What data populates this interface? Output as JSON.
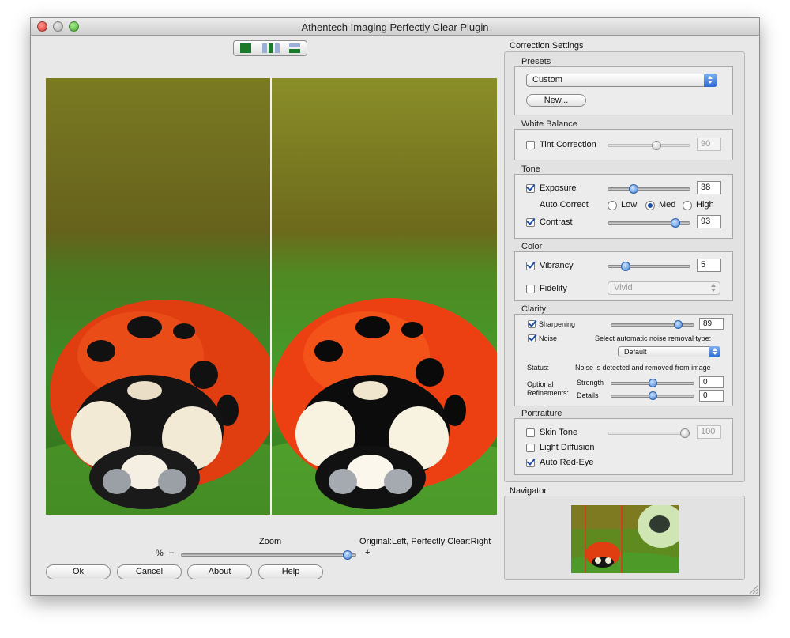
{
  "window": {
    "title": "Athentech Imaging Perfectly Clear Plugin"
  },
  "preview": {
    "zoom_label": "Zoom",
    "orientation_label": "Original:Left, Perfectly Clear:Right",
    "zoom_percent_label": "%",
    "zoom_minus": "–",
    "zoom_plus": "+",
    "zoom_level": 0.98
  },
  "buttons": {
    "ok": "Ok",
    "cancel": "Cancel",
    "about": "About",
    "help": "Help"
  },
  "settings": {
    "title": "Correction Settings",
    "presets": {
      "title": "Presets",
      "selected": "Custom",
      "new_label": "New..."
    },
    "white_balance": {
      "title": "White Balance",
      "tint": {
        "label": "Tint Correction",
        "checked": false,
        "value": "90",
        "level": 0.6
      }
    },
    "tone": {
      "title": "Tone",
      "exposure": {
        "label": "Exposure",
        "checked": true,
        "value": "38",
        "level": 0.29
      },
      "auto_correct": {
        "label": "Auto Correct",
        "options": [
          "Low",
          "Med",
          "High"
        ],
        "selected": "Med"
      },
      "contrast": {
        "label": "Contrast",
        "checked": true,
        "value": "93",
        "level": 0.87
      }
    },
    "color": {
      "title": "Color",
      "vibrancy": {
        "label": "Vibrancy",
        "checked": true,
        "value": "5",
        "level": 0.18
      },
      "fidelity": {
        "label": "Fidelity",
        "checked": false,
        "selected": "Vivid"
      }
    },
    "clarity": {
      "title": "Clarity",
      "sharpening": {
        "label": "Sharpening",
        "checked": true,
        "value": "89",
        "level": 0.85
      },
      "noise": {
        "label": "Noise",
        "checked": true,
        "prompt": "Select automatic noise removal type:",
        "selected": "Default"
      },
      "status_label": "Status:",
      "status_text": "Noise is detected and removed from image",
      "refinements_label_1": "Optional",
      "refinements_label_2": "Refinements:",
      "strength": {
        "label": "Strength",
        "value": "0",
        "level": 0.5
      },
      "details": {
        "label": "Details",
        "value": "0",
        "level": 0.5
      }
    },
    "portraiture": {
      "title": "Portraiture",
      "skin_tone": {
        "label": "Skin Tone",
        "checked": false,
        "value": "100",
        "level": 1.0
      },
      "light_diffusion": {
        "label": "Light Diffusion",
        "checked": false
      },
      "auto_red_eye": {
        "label": "Auto Red-Eye",
        "checked": true
      }
    }
  },
  "navigator": {
    "title": "Navigator"
  },
  "colors": {
    "accent": "#3e7fd6",
    "view_green": "#1a7a2a",
    "ladybug_red": "#e03d10"
  },
  "icons": {
    "window_close": "close-icon",
    "window_minimize": "minimize-icon",
    "window_zoom": "zoom-icon"
  }
}
